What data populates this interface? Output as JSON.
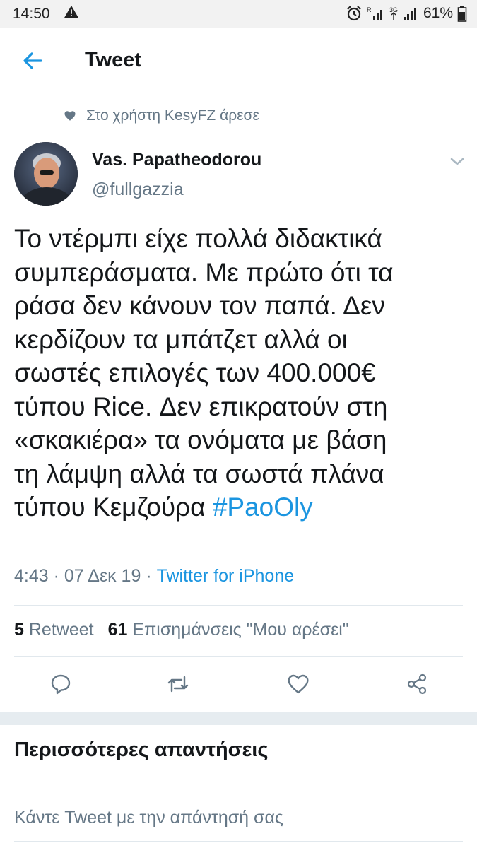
{
  "status_bar": {
    "time": "14:50",
    "battery": "61%"
  },
  "header": {
    "title": "Tweet"
  },
  "social_context": {
    "text": "Στο χρήστη KesyFZ άρεσε"
  },
  "tweet": {
    "author_name": "Vas. Papatheodorou",
    "author_handle": "@fullgazzia",
    "text_lines": [
      "Το ντέρμπι είχε πολλά διδακτικά",
      "συμπεράσματα. Με πρώτο ότι τα",
      "ράσα δεν κάνουν τον παπά. Δεν",
      "κερδίζουν τα μπάτζετ αλλά οι",
      "σωστές επιλογές των 400.000€",
      "τύπου Rice. Δεν επικρατούν στη",
      "«σκακιέρα» τα ονόματα με βάση",
      "τη λάμψη αλλά τα σωστά πλάνα",
      "τύπου Κεμζούρα "
    ],
    "hashtag": "#PaoOly",
    "time": "4:43",
    "separator": " · ",
    "date": "07 Δεκ 19",
    "source": "Twitter for iPhone",
    "retweet_count": "5",
    "retweet_label": "Retweet",
    "like_count": "61",
    "like_label": "Επισημάνσεις \"Μου αρέσει\""
  },
  "replies": {
    "heading": "Περισσότερες απαντήσεις",
    "prompt": "Κάντε Tweet με την απάντησή σας"
  },
  "icons": {
    "back": "arrow-left-icon",
    "liked": "heart-filled-icon",
    "caret": "chevron-down-icon",
    "reply": "speech-bubble-icon",
    "retweet": "retweet-arrows-icon",
    "like": "heart-outline-icon",
    "share": "share-nodes-icon"
  },
  "colors": {
    "accent": "#1b95e0",
    "secondary_text": "#657786",
    "divider": "#e1e8ed"
  }
}
